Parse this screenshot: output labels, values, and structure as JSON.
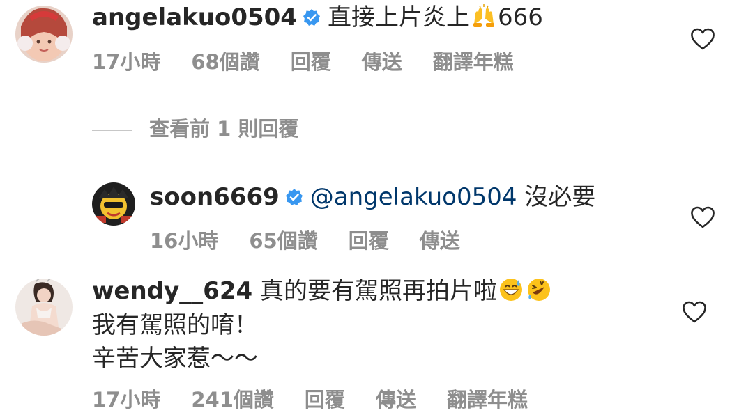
{
  "comments": [
    {
      "username": "angelakuo0504",
      "text": "直接上片炎上",
      "text_after_emoji": "666",
      "emoji": "raising-hands",
      "time": "17小時",
      "likes": "68個讚",
      "reply": "回覆",
      "send": "傳送",
      "translate": "翻譯年糕"
    },
    {
      "username": "soon6669",
      "mention": "@angelakuo0504",
      "text": "沒必要",
      "time": "16小時",
      "likes": "65個讚",
      "reply": "回覆",
      "send": "傳送"
    },
    {
      "username": "wendy__624",
      "text": "真的要有駕照再拍片啦",
      "emojis": [
        "grinning-sweat",
        "rolling-laughing"
      ],
      "line2": "我有駕照的唷！",
      "line3": "辛苦大家惹～～",
      "time": "17小時",
      "likes": "241個讚",
      "reply": "回覆",
      "send": "傳送",
      "translate": "翻譯年糕"
    }
  ],
  "view_replies": "查看前 1 則回覆",
  "colors": {
    "text": "#262626",
    "meta": "#8e8e8e",
    "mention": "#00376b",
    "verified": "#3897f0"
  }
}
